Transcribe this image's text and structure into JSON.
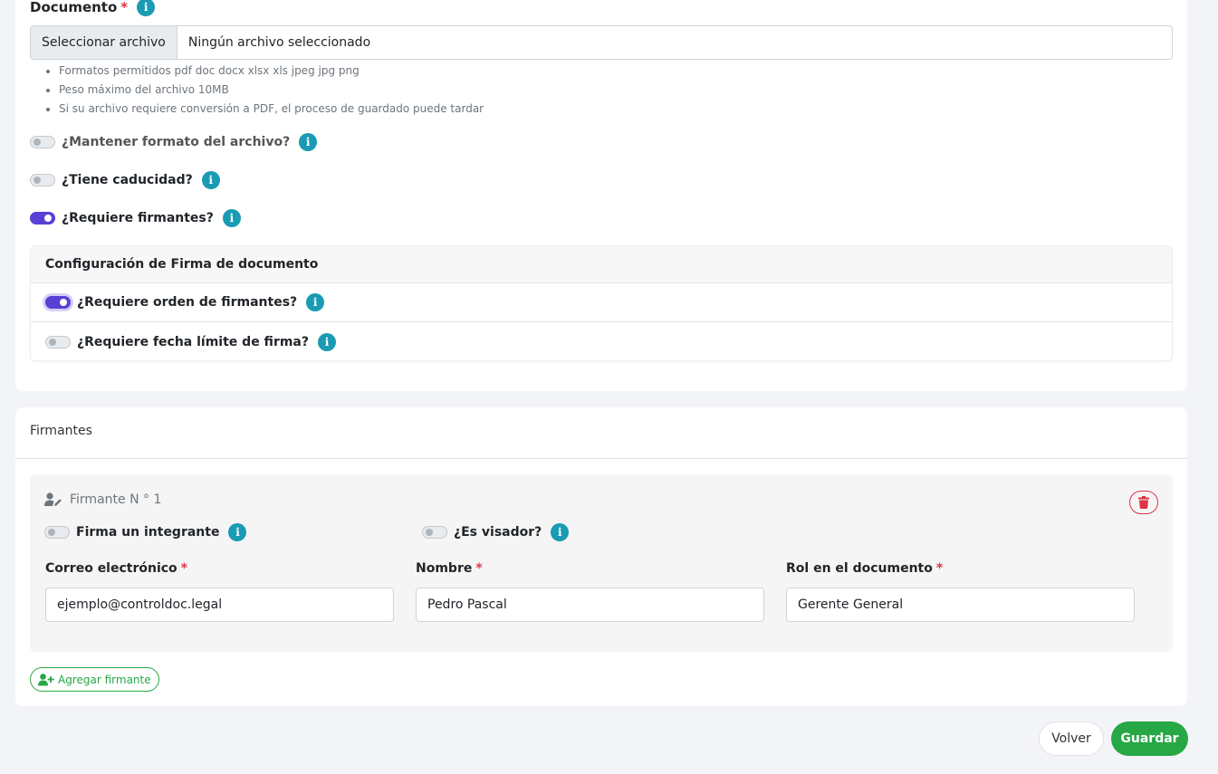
{
  "document": {
    "label": "Documento",
    "required_mark": "*",
    "file_button": "Seleccionar archivo",
    "file_status": "Ningún archivo seleccionado",
    "hints": [
      "Formatos permitidos pdf doc docx xlsx xls jpeg jpg png",
      "Peso máximo del archivo 10MB",
      "Si su archivo requiere conversión a PDF, el proceso de guardado puede tardar"
    ]
  },
  "toggles": {
    "keep_format": {
      "label": "¿Mantener formato del archivo?",
      "on": false
    },
    "expiry": {
      "label": "¿Tiene caducidad?",
      "on": false
    },
    "signers_required": {
      "label": "¿Requiere firmantes?",
      "on": true
    }
  },
  "signature_config": {
    "title": "Configuración de Firma de documento",
    "order": {
      "label": "¿Requiere orden de firmantes?",
      "on": true
    },
    "deadline": {
      "label": "¿Requiere fecha límite de firma?",
      "on": false
    }
  },
  "signers_section": {
    "title": "Firmantes",
    "signer": {
      "heading": "Firmante N ° 1",
      "member_toggle": {
        "label": "Firma un integrante",
        "on": false
      },
      "viewer_toggle": {
        "label": "¿Es visador?",
        "on": false
      },
      "email": {
        "label": "Correo electrónico",
        "value": "ejemplo@controldoc.legal"
      },
      "name": {
        "label": "Nombre",
        "value": "Pedro Pascal"
      },
      "role": {
        "label": "Rol en el documento",
        "value": "Gerente General"
      }
    },
    "add_button": "Agregar firmante"
  },
  "actions": {
    "back": "Volver",
    "save": "Guardar"
  },
  "colors": {
    "accent": "#5a3fd6",
    "info": "#1a9bb3",
    "success": "#28a745",
    "danger": "#dc3545"
  },
  "icons": {
    "info": "info-icon",
    "user_edit": "user-edit-icon",
    "trash": "trash-icon",
    "user_plus": "user-plus-icon"
  }
}
